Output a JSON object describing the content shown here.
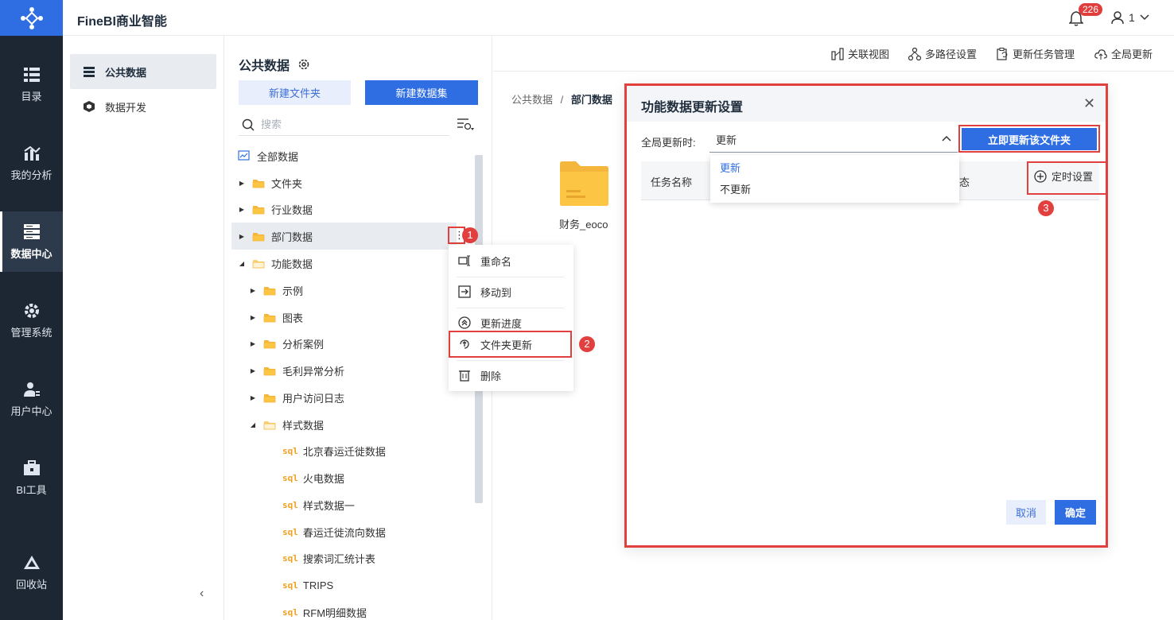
{
  "app": {
    "title": "FineBI商业智能",
    "notification_count": "226",
    "user": "1"
  },
  "leftnav": [
    {
      "label": "目录",
      "icon": "catalog-icon"
    },
    {
      "label": "我的分析",
      "icon": "analysis-icon"
    },
    {
      "label": "数据中心",
      "icon": "data-center-icon",
      "active": true
    },
    {
      "label": "管理系统",
      "icon": "gear-icon"
    },
    {
      "label": "用户中心",
      "icon": "user-center-icon"
    },
    {
      "label": "BI工具",
      "icon": "toolbox-icon"
    },
    {
      "label": "回收站",
      "icon": "recycle-icon"
    }
  ],
  "subnav": {
    "items": [
      {
        "label": "公共数据"
      },
      {
        "label": "数据开发"
      }
    ]
  },
  "tree": {
    "title": "公共数据",
    "new_folder": "新建文件夹",
    "new_dataset": "新建数据集",
    "search_placeholder": "搜索",
    "rows": [
      {
        "label": "全部数据",
        "kind": "root"
      },
      {
        "label": "文件夹",
        "kind": "folder"
      },
      {
        "label": "行业数据",
        "kind": "folder"
      },
      {
        "label": "部门数据",
        "kind": "folder"
      },
      {
        "label": "功能数据",
        "kind": "folder-open"
      },
      {
        "label": "示例",
        "kind": "folder"
      },
      {
        "label": "图表",
        "kind": "folder"
      },
      {
        "label": "分析案例",
        "kind": "folder"
      },
      {
        "label": "毛利异常分析",
        "kind": "folder"
      },
      {
        "label": "用户访问日志",
        "kind": "folder"
      },
      {
        "label": "样式数据",
        "kind": "folder-open"
      },
      {
        "label": "北京春运迁徙数据",
        "kind": "sql"
      },
      {
        "label": "火电数据",
        "kind": "sql"
      },
      {
        "label": "样式数据一",
        "kind": "sql"
      },
      {
        "label": "春运迁徙流向数据",
        "kind": "sql"
      },
      {
        "label": "搜索词汇统计表",
        "kind": "sql"
      },
      {
        "label": "TRIPS",
        "kind": "sql"
      },
      {
        "label": "RFM明细数据",
        "kind": "sql"
      }
    ],
    "sql_tag": "sql"
  },
  "context_menu": {
    "items": [
      {
        "label": "重命名",
        "icon": "rename-icon"
      },
      {
        "label": "移动到",
        "icon": "move-icon"
      },
      {
        "label": "更新进度",
        "icon": "progress-icon"
      },
      {
        "label": "文件夹更新",
        "icon": "folder-update-icon"
      },
      {
        "label": "删除",
        "icon": "trash-icon"
      }
    ]
  },
  "markers": [
    "1",
    "2",
    "3"
  ],
  "toolbar": {
    "relation_view": "关联视图",
    "multipath": "多路径设置",
    "task_manage": "更新任务管理",
    "global_update": "全局更新"
  },
  "breadcrumb": {
    "root": "公共数据",
    "sep": "/",
    "current": "部门数据"
  },
  "folder_card": {
    "name": "财务_eoco"
  },
  "dialog": {
    "title": "功能数据更新设置",
    "global_label": "全局更新时:",
    "select_value": "更新",
    "update_now": "立即更新该文件夹",
    "options": [
      "更新",
      "不更新"
    ],
    "col_task": "任务名称",
    "col_status": "态",
    "schedule": "定时设置",
    "cancel": "取消",
    "ok": "确定"
  },
  "colors": {
    "primary": "#2f6ee2",
    "nav_bg": "#1d2733",
    "highlight": "#e2403f"
  }
}
